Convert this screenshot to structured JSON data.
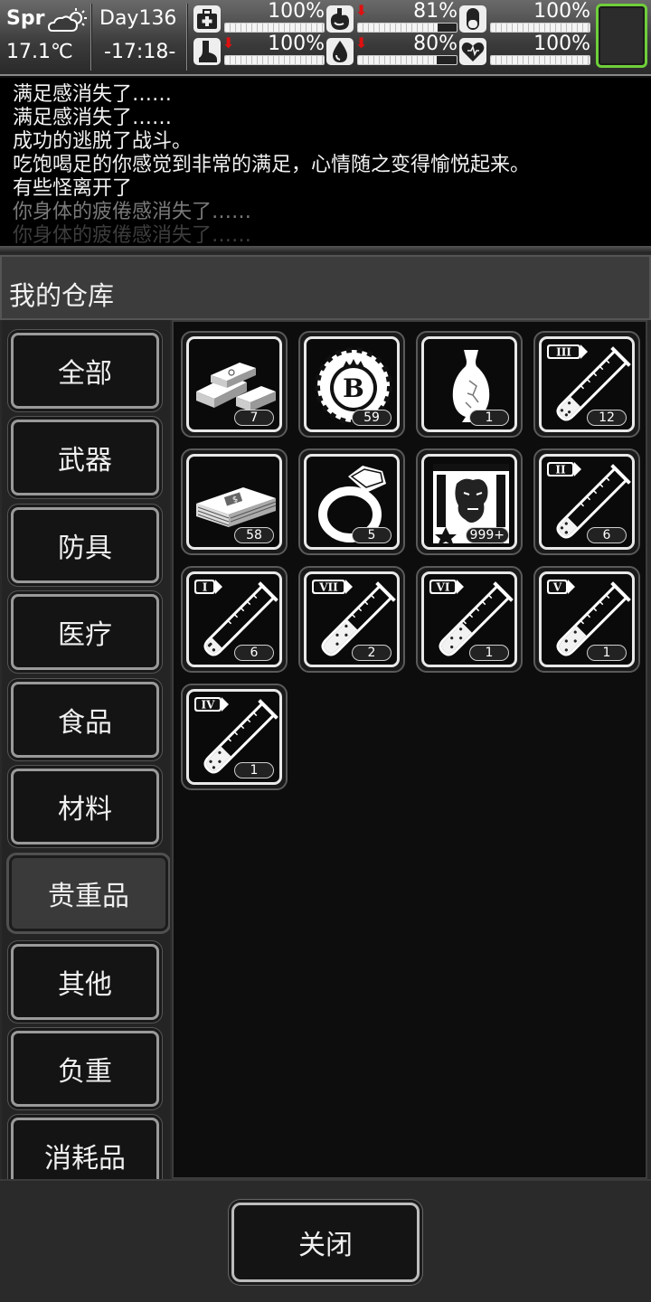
{
  "status": {
    "season": "Spr",
    "temperature": "17.1℃",
    "day": "Day136",
    "time": "-17:18-",
    "weather_icon": "partly-cloudy-sun-icon",
    "stats": [
      {
        "name": "health",
        "icon": "first-aid-kit-icon",
        "percent": "100%",
        "level": 1.0,
        "down": false
      },
      {
        "name": "hunger",
        "icon": "stomach-icon",
        "percent": "81%",
        "level": 0.81,
        "down": true
      },
      {
        "name": "immunity",
        "icon": "capsule-icon",
        "percent": "100%",
        "level": 1.0,
        "down": false
      },
      {
        "name": "stamina",
        "icon": "foot-icon",
        "percent": "100%",
        "level": 1.0,
        "down": true
      },
      {
        "name": "thirst",
        "icon": "water-drop-icon",
        "percent": "80%",
        "level": 0.8,
        "down": true
      },
      {
        "name": "mood",
        "icon": "heart-icon",
        "percent": "100%",
        "level": 1.0,
        "down": false
      }
    ],
    "down_arrow": "⬇"
  },
  "log": [
    "满足感消失了……",
    "满足感消失了……",
    "成功的逃脱了战斗。",
    "吃饱喝足的你感觉到非常的满足，心情随之变得愉悦起来。",
    "有些怪离开了",
    "你身体的疲倦感消失了……",
    "你身体的疲倦感消失了……"
  ],
  "panel": {
    "title": "我的仓库",
    "categories": [
      "全部",
      "武器",
      "防具",
      "医疗",
      "食品",
      "材料",
      "贵重品",
      "其他",
      "负重",
      "消耗品"
    ],
    "active_category": "贵重品",
    "close_label": "关闭"
  },
  "items": [
    {
      "icon": "gold-bars-icon",
      "count": "7"
    },
    {
      "icon": "casino-chip-icon",
      "count": "59"
    },
    {
      "icon": "porcelain-vase-icon",
      "count": "1"
    },
    {
      "icon": "test-tube-III-icon",
      "tier": "III",
      "fill": 0.25,
      "count": "12"
    },
    {
      "icon": "cash-stack-icon",
      "count": "58"
    },
    {
      "icon": "diamond-ring-icon",
      "count": "5"
    },
    {
      "icon": "zombie-poster-icon",
      "count": "999+"
    },
    {
      "icon": "test-tube-II-icon",
      "tier": "II",
      "fill": 0.2,
      "count": "6"
    },
    {
      "icon": "test-tube-I-icon",
      "tier": "I",
      "fill": 0.15,
      "count": "6"
    },
    {
      "icon": "test-tube-VII-icon",
      "tier": "VII",
      "fill": 0.45,
      "count": "2"
    },
    {
      "icon": "test-tube-VI-icon",
      "tier": "VI",
      "fill": 0.4,
      "count": "1"
    },
    {
      "icon": "test-tube-V-icon",
      "tier": "V",
      "fill": 0.35,
      "count": "1"
    },
    {
      "icon": "test-tube-IV-icon",
      "tier": "IV",
      "fill": 0.3,
      "count": "1"
    }
  ]
}
